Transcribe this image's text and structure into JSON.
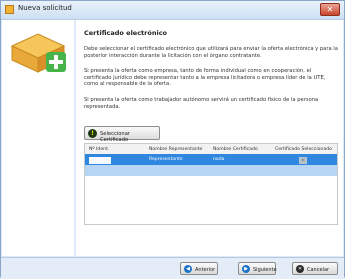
{
  "window": {
    "title": "Nueva solicitud",
    "close_glyph": "✕",
    "icon": "app-icon"
  },
  "left_panel": {
    "icon": "certificate-box-icon"
  },
  "content": {
    "heading": "Certificado electrónico",
    "paragraph_1": "Debe seleccionar el certificado electrónico que utilizará para enviar la oferta electrónica y para la posterior interacción durante la licitación con el órgano contratante.",
    "paragraph_2": "Si presenta la oferta como empresa, tanto de forma individual como en cooperación, el certificado jurídico debe representar tanto a la empresa licitadora o empresa líder de la UTE, como al responsable de la oferta.",
    "paragraph_3": "Si presenta la oferta como trabajador autónomo servirá un certificado físico de la persona representada.",
    "select_button": "Seleccionar Certificado",
    "select_icon": "!"
  },
  "table": {
    "headers": [
      "Nº Ident.",
      "Nombre Representante",
      "Nombre Certificado",
      "Certificado Seleccionado"
    ],
    "rows": [
      {
        "nif": "",
        "representante": "Representante",
        "certificado": "nada",
        "seleccionado": "✕"
      }
    ]
  },
  "footer": {
    "prev": "Anterior",
    "next": "Siguiente",
    "cancel": "Cancelar",
    "prev_glyph": "◀",
    "next_glyph": "▶",
    "cancel_glyph": "✕"
  },
  "colors": {
    "accent": "#2f87e0",
    "titlebar": "#cddff3",
    "close": "#c9452c"
  }
}
